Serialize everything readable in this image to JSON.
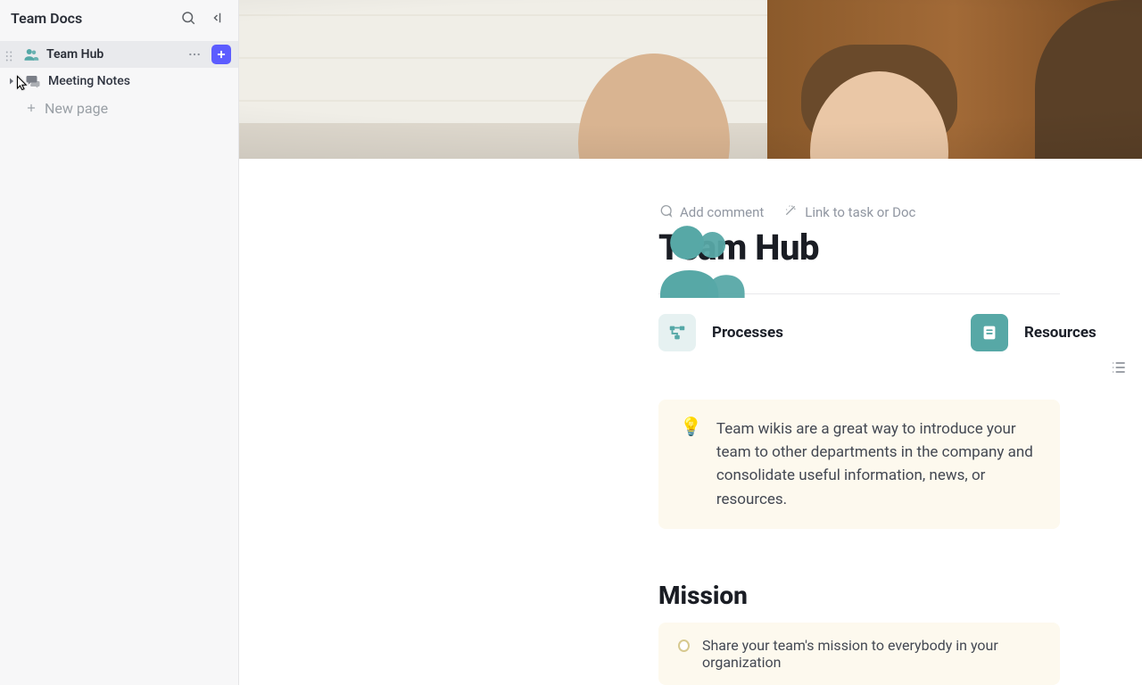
{
  "sidebar": {
    "title": "Team Docs",
    "items": [
      {
        "label": "Team Hub"
      },
      {
        "label": "Meeting Notes"
      }
    ],
    "newPage": "New page"
  },
  "actions": {
    "addComment": "Add comment",
    "linkTask": "Link to task or Doc"
  },
  "doc": {
    "title": "Team Hub",
    "cards": {
      "processes": "Processes",
      "resources": "Resources"
    },
    "tip": "Team wikis are a great way to introduce your team to other departments in the company and consolidate useful information, news, or resources.",
    "section1Title": "Mission",
    "section1Body": "Share your team's mission to everybody in your organization"
  }
}
